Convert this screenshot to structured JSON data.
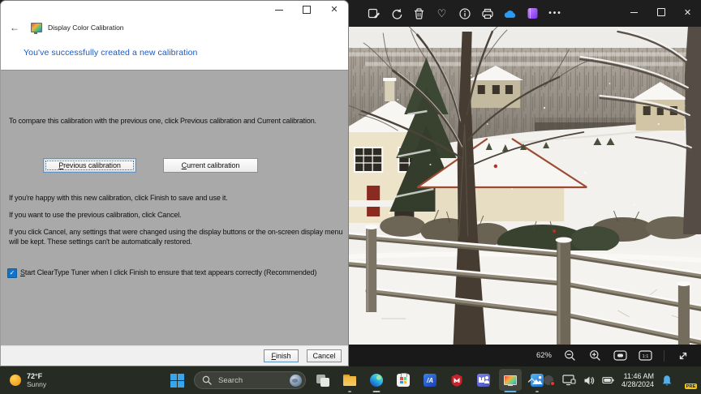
{
  "colors": {
    "wizard_heading": "#1959c8",
    "wizard_body_bg": "#a9a9a9",
    "taskbar_bg": "#262b23",
    "active_app_underline": "#5ab4e8",
    "onedrive_blue": "#2a9bf2"
  },
  "calibration_window": {
    "app_title": "Display Color Calibration",
    "heading": "You've successfully created a new calibration",
    "intro": "To compare this calibration with the previous one, click Previous calibration and Current calibration.",
    "compare_buttons": {
      "previous": "Previous calibration",
      "current": "Current calibration"
    },
    "paragraphs": [
      "If you're happy with this new calibration, click Finish to save and use it.",
      "If you want to use the previous calibration, click Cancel.",
      "If you click Cancel, any settings that were changed using the display buttons or the on-screen display menu will be kept. These settings can't be automatically restored."
    ],
    "cleartype_checkbox": {
      "checked": true,
      "check_glyph": "✓",
      "label": "Start ClearType Tuner when I click Finish to ensure that text appears correctly (Recommended)"
    },
    "footer_buttons": {
      "finish": "Finish",
      "cancel": "Cancel"
    }
  },
  "photos_window": {
    "toolbar_icons": [
      "edit-image",
      "rotate",
      "delete",
      "favorite",
      "file-info",
      "print",
      "save-to-onedrive",
      "clipchamp",
      "see-more"
    ],
    "statusbar": {
      "zoom_level": "62%"
    }
  },
  "taskbar": {
    "weather": {
      "temperature": "72°F",
      "condition": "Sunny"
    },
    "search": {
      "placeholder": "Search"
    },
    "clock": {
      "time": "11:46 AM",
      "date": "4/28/2024"
    },
    "copilot_badge": "PRE"
  }
}
